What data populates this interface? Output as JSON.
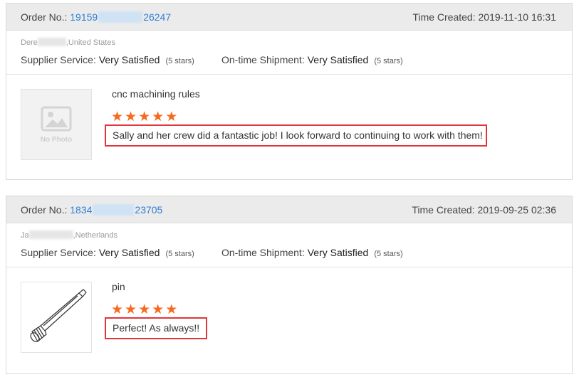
{
  "labels": {
    "order_no": "Order No.:",
    "time_created": "Time Created:",
    "supplier_service": "Supplier Service:",
    "ontime_shipment": "On-time Shipment:",
    "no_photo": "No Photo"
  },
  "reviews": [
    {
      "order_prefix": "19159",
      "order_suffix": "26247",
      "time_created": "2019-11-10 16:31",
      "buyer_prefix": "Dere",
      "buyer_country": ",United States",
      "supplier_service_value": "Very Satisfied",
      "supplier_service_stars": "(5 stars)",
      "ontime_value": "Very Satisfied",
      "ontime_stars": "(5 stars)",
      "product_name": "cnc machining rules",
      "rating_stars": 5,
      "comment": "Sally and her crew did a fantastic job! I look forward to continuing to work with them!",
      "image": "no-photo-placeholder"
    },
    {
      "order_prefix": "1834",
      "order_suffix": "23705",
      "time_created": "2019-09-25 02:36",
      "buyer_prefix": "Ja",
      "buyer_country": ",Netherlands",
      "supplier_service_value": "Very Satisfied",
      "supplier_service_stars": "(5 stars)",
      "ontime_value": "Very Satisfied",
      "ontime_stars": "(5 stars)",
      "product_name": "pin",
      "rating_stars": 5,
      "comment": "Perfect! As always!!",
      "image": "pin-part-icon"
    }
  ],
  "colors": {
    "link": "#2f7fd6",
    "star": "#f56a1f",
    "highlight_border": "#e0353a",
    "header_bg": "#ebebeb"
  }
}
